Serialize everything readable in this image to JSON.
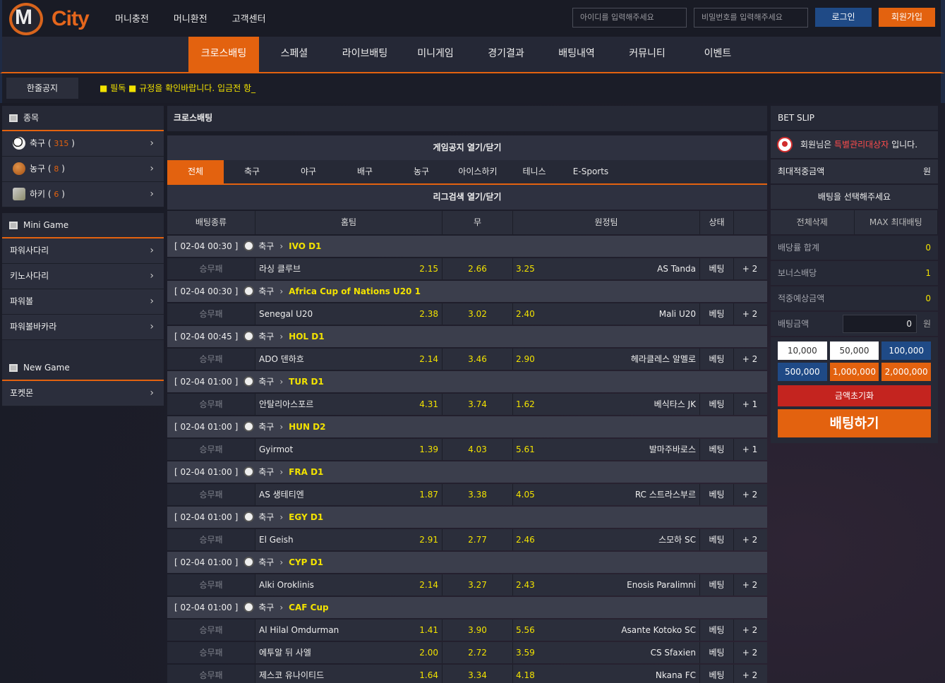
{
  "brand": {
    "m": "M",
    "name": "City"
  },
  "top_menu": [
    "머니충전",
    "머니환전",
    "고객센터"
  ],
  "login": {
    "id_placeholder": "아이디를 입력해주세요",
    "pw_placeholder": "비밀번호를 입력해주세요",
    "login": "로그인",
    "join": "회원가입"
  },
  "nav": [
    "크로스배팅",
    "스페셜",
    "라이브배팅",
    "미니게임",
    "경기결과",
    "배팅내역",
    "커뮤니티",
    "이벤트"
  ],
  "notice": {
    "label": "한줄공지",
    "text": "■ 필독 ■ 규정을 확인바랍니다. 입금전 항_"
  },
  "left": {
    "sports_title": "종목",
    "sports": [
      {
        "name": "축구",
        "count": "315"
      },
      {
        "name": "농구",
        "count": "8"
      },
      {
        "name": "하키",
        "count": "6"
      }
    ],
    "mini_title": "Mini Game",
    "mini": [
      "파워사다리",
      "키노사다리",
      "파워볼",
      "파워볼바카라"
    ],
    "new_title": "New Game",
    "new": [
      "포켓몬"
    ]
  },
  "center": {
    "title": "크로스배팅",
    "game_notice": "게임공지 열기/닫기",
    "tabs": [
      "전체",
      "축구",
      "야구",
      "배구",
      "농구",
      "아이스하키",
      "테니스",
      "E-Sports"
    ],
    "league_search": "리그검색 열기/닫기",
    "columns": [
      "배팅종류",
      "홈팀",
      "무",
      "원정팀",
      "상태"
    ],
    "games": [
      {
        "time": "[ 02-04 00:30 ]",
        "sport": "축구",
        "league": "IVO D1",
        "rows": [
          {
            "type": "승무패",
            "home": "라싱 클루브",
            "h": "2.15",
            "d": "2.66",
            "a": "3.25",
            "away": "AS Tanda",
            "st": "베팅",
            "more": "+ 2"
          }
        ]
      },
      {
        "time": "[ 02-04 00:30 ]",
        "sport": "축구",
        "league": "Africa Cup of Nations U20 1",
        "rows": [
          {
            "type": "승무패",
            "home": "Senegal U20",
            "h": "2.38",
            "d": "3.02",
            "a": "2.40",
            "away": "Mali U20",
            "st": "베팅",
            "more": "+ 2"
          }
        ]
      },
      {
        "time": "[ 02-04 00:45 ]",
        "sport": "축구",
        "league": "HOL D1",
        "rows": [
          {
            "type": "승무패",
            "home": "ADO 덴하흐",
            "h": "2.14",
            "d": "3.46",
            "a": "2.90",
            "away": "헤라클레스 알멜로",
            "st": "베팅",
            "more": "+ 2"
          }
        ]
      },
      {
        "time": "[ 02-04 01:00 ]",
        "sport": "축구",
        "league": "TUR D1",
        "rows": [
          {
            "type": "승무패",
            "home": "안탈리아스포르",
            "h": "4.31",
            "d": "3.74",
            "a": "1.62",
            "away": "베식타스 JK",
            "st": "베팅",
            "more": "+ 1"
          }
        ]
      },
      {
        "time": "[ 02-04 01:00 ]",
        "sport": "축구",
        "league": "HUN D2",
        "rows": [
          {
            "type": "승무패",
            "home": "Gyirmot",
            "h": "1.39",
            "d": "4.03",
            "a": "5.61",
            "away": "발마주바로스",
            "st": "베팅",
            "more": "+ 1"
          }
        ]
      },
      {
        "time": "[ 02-04 01:00 ]",
        "sport": "축구",
        "league": "FRA D1",
        "rows": [
          {
            "type": "승무패",
            "home": "AS 생테티엔",
            "h": "1.87",
            "d": "3.38",
            "a": "4.05",
            "away": "RC 스트라스부르",
            "st": "베팅",
            "more": "+ 2"
          }
        ]
      },
      {
        "time": "[ 02-04 01:00 ]",
        "sport": "축구",
        "league": "EGY D1",
        "rows": [
          {
            "type": "승무패",
            "home": "El Geish",
            "h": "2.91",
            "d": "2.77",
            "a": "2.46",
            "away": "스모하 SC",
            "st": "베팅",
            "more": "+ 2"
          }
        ]
      },
      {
        "time": "[ 02-04 01:00 ]",
        "sport": "축구",
        "league": "CYP D1",
        "rows": [
          {
            "type": "승무패",
            "home": "Alki Oroklinis",
            "h": "2.14",
            "d": "3.27",
            "a": "2.43",
            "away": "Enosis Paralimni",
            "st": "베팅",
            "more": "+ 2"
          }
        ]
      },
      {
        "time": "[ 02-04 01:00 ]",
        "sport": "축구",
        "league": "CAF Cup",
        "rows": [
          {
            "type": "승무패",
            "home": "Al Hilal Omdurman",
            "h": "1.41",
            "d": "3.90",
            "a": "5.56",
            "away": "Asante Kotoko SC",
            "st": "베팅",
            "more": "+ 2"
          },
          {
            "type": "승무패",
            "home": "에투알 뒤 사엘",
            "h": "2.00",
            "d": "2.72",
            "a": "3.59",
            "away": "CS Sfaxien",
            "st": "베팅",
            "more": "+ 2"
          },
          {
            "type": "승무패",
            "home": "제스코 유나이티드",
            "h": "1.64",
            "d": "3.34",
            "a": "4.18",
            "away": "Nkana FC",
            "st": "베팅",
            "more": "+ 2"
          }
        ]
      }
    ]
  },
  "slip": {
    "title": "BET SLIP",
    "member_pre": "회원님은 ",
    "member_red": "특별관리대상자",
    "member_post": " 입니다.",
    "max_label": "최대적중금액",
    "max_unit": "원",
    "select_msg": "배팅을 선택해주세요",
    "clear_all": "전체삭제",
    "max_bet": "MAX 최대배팅",
    "odds_sum_label": "배당률 합계",
    "odds_sum": "0",
    "bonus_label": "보너스배당",
    "bonus": "1",
    "expected_label": "적중예상금액",
    "expected": "0",
    "amount_label": "배팅금액",
    "amount": "0",
    "amount_unit": "원",
    "chips": [
      "10,000",
      "50,000",
      "100,000",
      "500,000",
      "1,000,000",
      "2,000,000"
    ],
    "reset": "금액초기화",
    "bet": "배팅하기"
  }
}
